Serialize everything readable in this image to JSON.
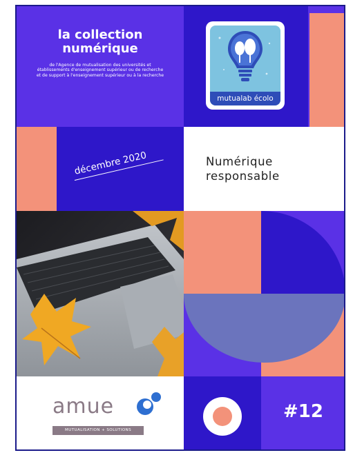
{
  "header": {
    "title_line1": "la collection",
    "title_line2": "numérique",
    "subtitle": "de l'Agence de mutualisation des universités et établissements d'enseignement supérieur ou de recherche et de support à l'enseignement supérieur ou à la recherche"
  },
  "logo": {
    "label": "mutualab écolo"
  },
  "date": "décembre 2020",
  "topic": {
    "line1": "Numérique",
    "line2": "responsable"
  },
  "brand": {
    "name": "amue",
    "tagline": "MUTUALISATION + SOLUTIONS"
  },
  "issue": "#12",
  "colors": {
    "violet": "#5a31e6",
    "indigo": "#2e17c9",
    "salmon": "#f3927a",
    "slate_blue": "#6b74bd",
    "amue_gray": "#8a7a86"
  }
}
